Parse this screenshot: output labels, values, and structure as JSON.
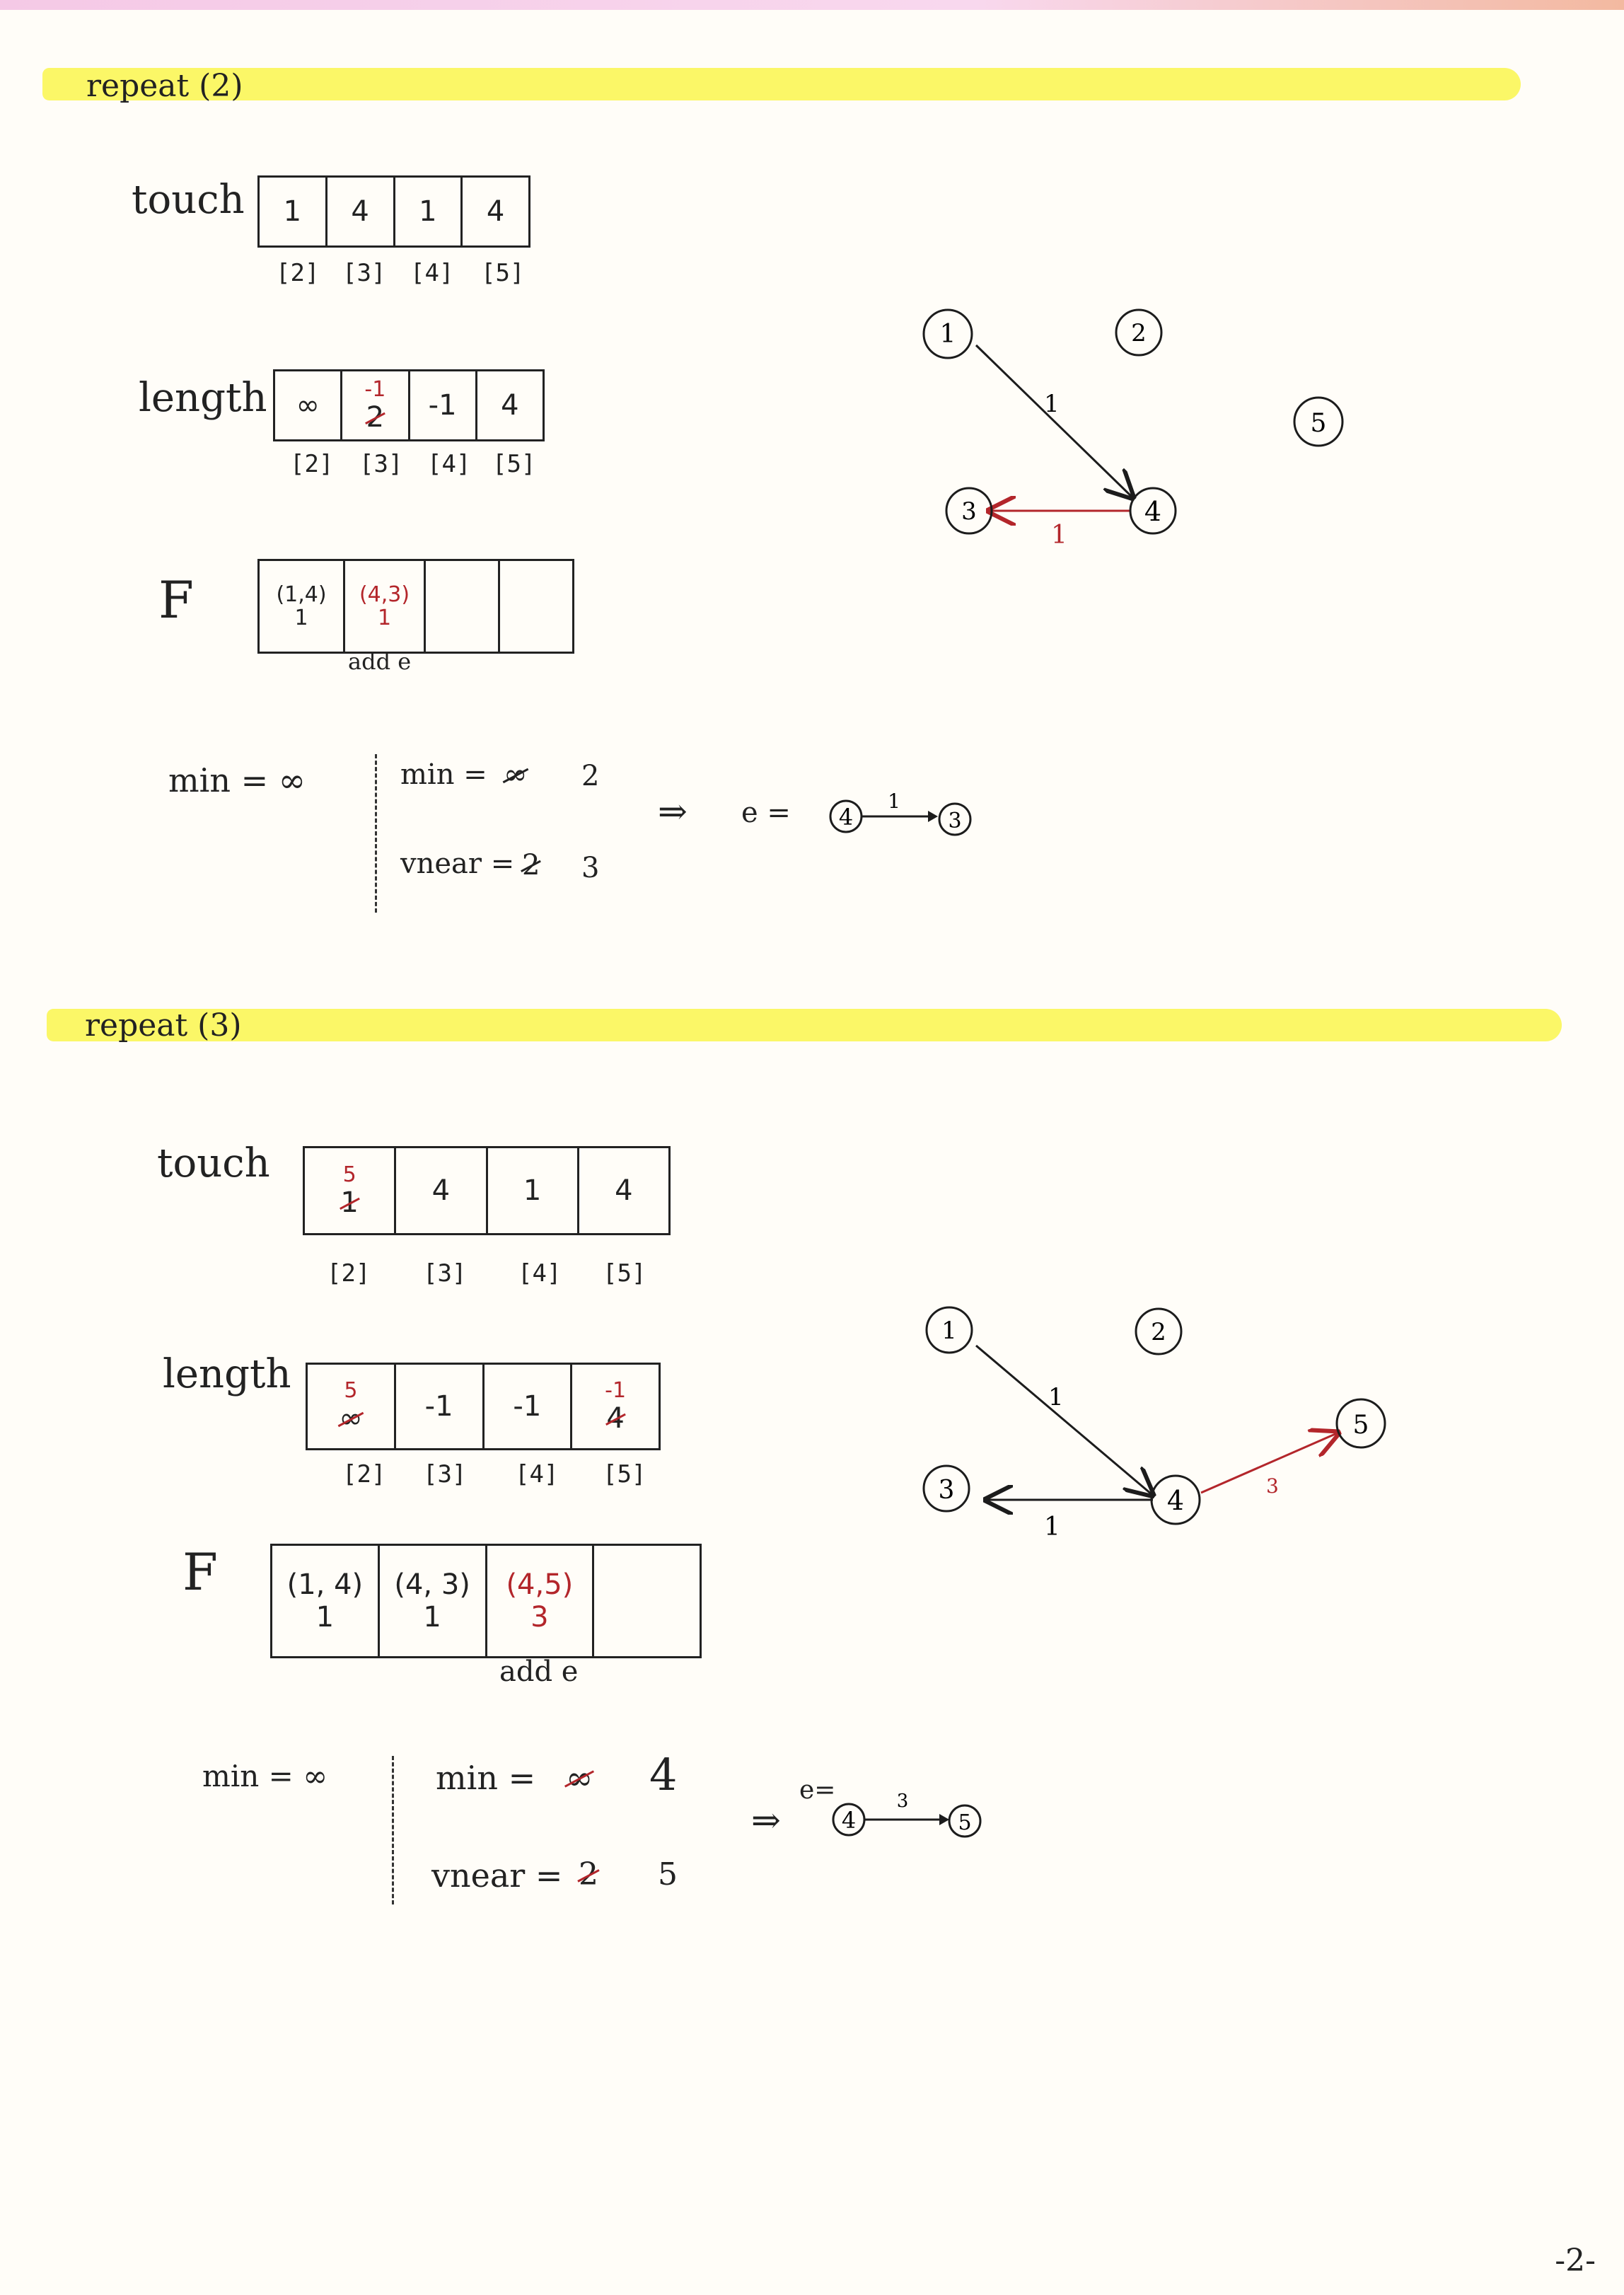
{
  "repeat2": {
    "title": "repeat (2)",
    "touch": {
      "label": "touch",
      "cells": [
        "1",
        "4",
        "1",
        "4"
      ],
      "indices": [
        "[2]",
        "[3]",
        "[4]",
        "[5]"
      ]
    },
    "length": {
      "label": "length",
      "cells": [
        {
          "value": "∞"
        },
        {
          "old": "2",
          "new": "-1"
        },
        {
          "value": "-1"
        },
        {
          "value": "4"
        }
      ],
      "indices": [
        "[2]",
        "[3]",
        "[4]",
        "[5]"
      ]
    },
    "F": {
      "label": "F",
      "cells": [
        {
          "edge": "(1,4)",
          "weight": "1"
        },
        {
          "edge": "(4,3)",
          "weight": "1"
        },
        {
          "edge": "",
          "weight": ""
        },
        {
          "edge": "",
          "weight": ""
        }
      ],
      "note": "add e"
    },
    "calc": {
      "min_left": "min = ∞",
      "min_right_label": "min =",
      "min_old": "∞",
      "min_new": "2",
      "vnear_label": "vnear =",
      "vnear_old": "2",
      "vnear_new": "3",
      "implies": "⇒",
      "e_label": "e =",
      "e_from": "4",
      "e_weight": "1",
      "e_to": "3"
    },
    "graph": {
      "nodes": [
        "1",
        "2",
        "3",
        "4",
        "5"
      ],
      "edges": [
        {
          "from": "1",
          "to": "4",
          "weight": "1",
          "color": "#1c1c1c"
        },
        {
          "from": "4",
          "to": "3",
          "weight": "1",
          "color": "#b3262b"
        }
      ]
    }
  },
  "repeat3": {
    "title": "repeat (3)",
    "touch": {
      "label": "touch",
      "cells": [
        {
          "old": "1",
          "new": "5"
        },
        {
          "value": "4"
        },
        {
          "value": "1"
        },
        {
          "value": "4"
        }
      ],
      "indices": [
        "[2]",
        "[3]",
        "[4]",
        "[5]"
      ]
    },
    "length": {
      "label": "length",
      "cells": [
        {
          "old": "∞",
          "new": "5"
        },
        {
          "value": "-1"
        },
        {
          "value": "-1"
        },
        {
          "old": "4",
          "new": "-1"
        }
      ],
      "indices": [
        "[2]",
        "[3]",
        "[4]",
        "[5]"
      ]
    },
    "F": {
      "label": "F",
      "cells": [
        {
          "edge": "(1, 4)",
          "weight": "1"
        },
        {
          "edge": "(4, 3)",
          "weight": "1"
        },
        {
          "edge": "(4,5)",
          "weight": "3"
        },
        {
          "edge": "",
          "weight": ""
        }
      ],
      "note": "add e"
    },
    "calc": {
      "min_left": "min = ∞",
      "min_right_label": "min =",
      "min_old": "∞",
      "min_new": "4",
      "vnear_label": "vnear =",
      "vnear_old": "2",
      "vnear_new": "5",
      "implies": "⇒",
      "e_label": "e=",
      "e_from": "4",
      "e_weight": "3",
      "e_to": "5"
    },
    "graph": {
      "nodes": [
        "1",
        "2",
        "3",
        "4",
        "5"
      ],
      "edges": [
        {
          "from": "1",
          "to": "4",
          "weight": "1",
          "color": "#1c1c1c"
        },
        {
          "from": "4",
          "to": "3",
          "weight": "1",
          "color": "#1c1c1c"
        },
        {
          "from": "4",
          "to": "5",
          "weight": "3",
          "color": "#b3262b"
        }
      ]
    }
  },
  "page_number": "-2-",
  "colors": {
    "highlight": "#fbf65a",
    "ink": "#1c1c1c",
    "red_ink": "#b3262b"
  }
}
